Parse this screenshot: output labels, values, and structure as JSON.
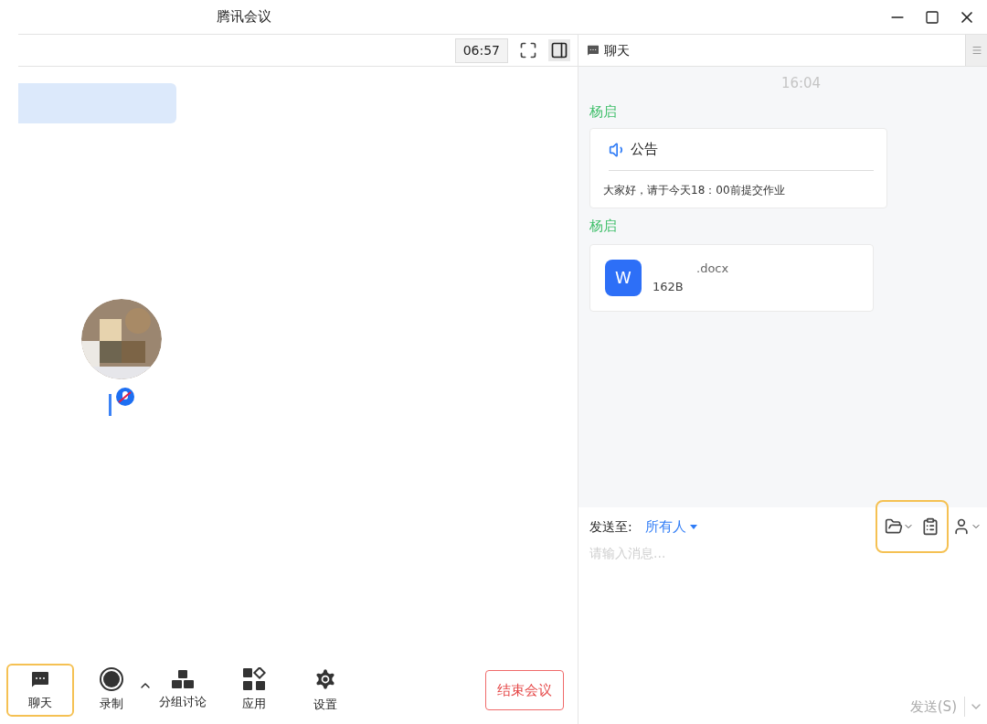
{
  "window": {
    "title": "腾讯会议"
  },
  "meeting": {
    "timer": "06:57"
  },
  "chat": {
    "title": "聊天",
    "time": "16:04",
    "messages": [
      {
        "kind": "notice",
        "sender": "杨启",
        "heading": "公告",
        "body": "大家好，请于今天18：00前提交作业"
      },
      {
        "kind": "file",
        "sender": "杨启",
        "file_letter": "W",
        "file_name": ".docx",
        "file_size": "162B"
      }
    ],
    "send_to_label": "发送至:",
    "recipient": "所有人",
    "placeholder": "请输入消息...",
    "tools_highlighted": true,
    "send_button": "发送(S)"
  },
  "toolbar": [
    {
      "label": "聊天",
      "kind": "chat",
      "highlighted": true
    },
    {
      "label": "录制",
      "kind": "record",
      "highlighted": false
    },
    {
      "label": "分组讨论",
      "kind": "groups",
      "highlighted": false
    },
    {
      "label": "应用",
      "kind": "apps",
      "highlighted": false
    },
    {
      "label": "设置",
      "kind": "settings",
      "highlighted": false
    }
  ],
  "end_button": "结束会议"
}
